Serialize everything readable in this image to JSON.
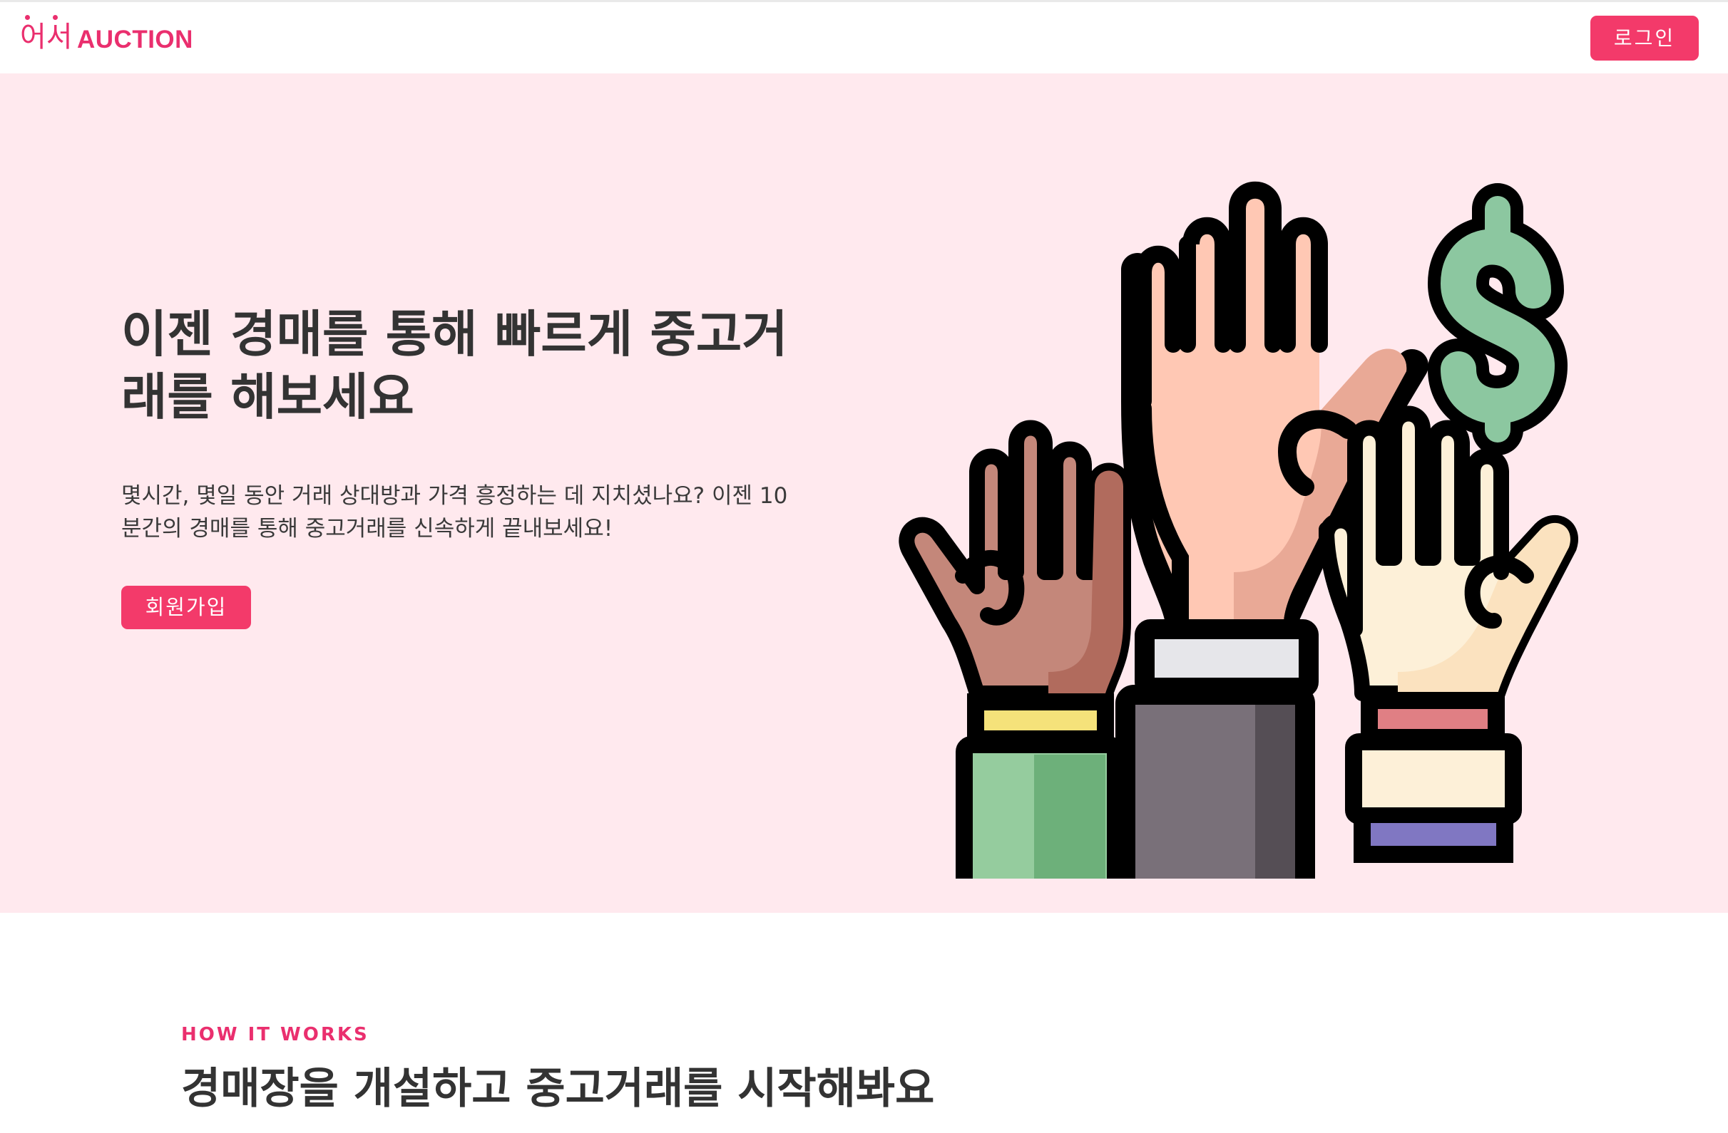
{
  "header": {
    "logo_korean": "어서",
    "logo_english": "AUCTION",
    "login_label": "로그인"
  },
  "hero": {
    "title": "이젠 경매를 통해 빠르게 중고거래를 해보세요",
    "description": "몇시간, 몇일 동안 거래 상대방과 가격 흥정하는 데 지치셨나요? 이젠 10분간의 경매를 통해 중고거래를 신속하게 끝내보세요!",
    "signup_label": "회원가입",
    "illustration_icons": [
      "raised-hands-icon",
      "dollar-sign-icon"
    ]
  },
  "how_it_works": {
    "eyebrow": "HOW IT WORKS",
    "title": "경매장을 개설하고 중고거래를 시작해봐요"
  },
  "colors": {
    "brand": "#ea2f6e",
    "button": "#f33a6a",
    "hero_background": "#ffe9ee",
    "text": "#333333"
  }
}
